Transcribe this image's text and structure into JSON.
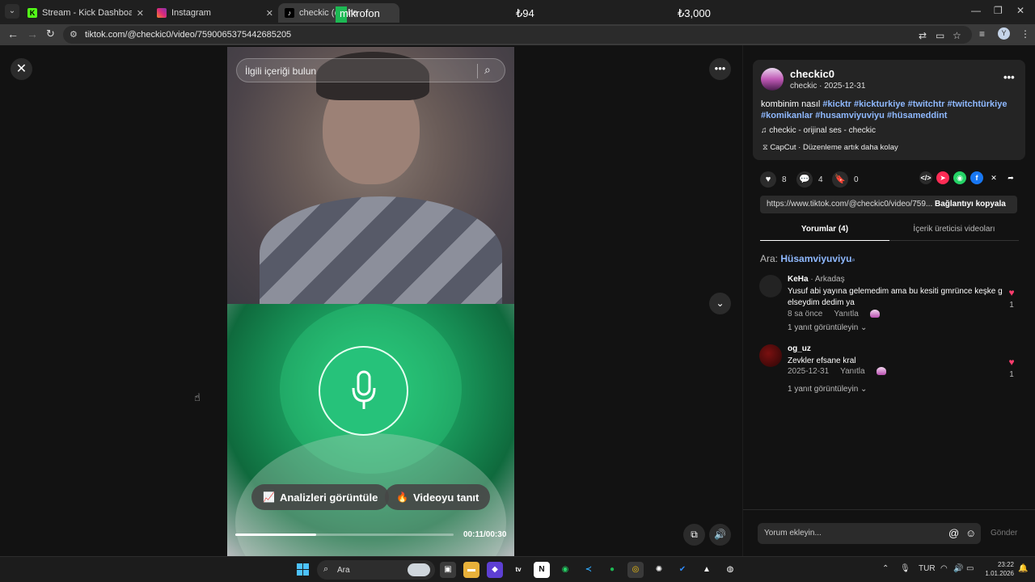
{
  "browser": {
    "tabs": [
      {
        "label": "Stream - Kick Dashboard",
        "favicon": "kick-icon",
        "color": "#53fc18"
      },
      {
        "label": "Instagram",
        "favicon": "instagram-icon",
        "color": "#e1306c"
      },
      {
        "label": "checkic (@che",
        "favicon": "tiktok-icon",
        "color": "#ffffff"
      }
    ],
    "overlay": {
      "mic_label": "mikrofon",
      "amount1": "₺94",
      "amount2": "₺3,000"
    },
    "url": "tiktok.com/@checkic0/video/7590065375442685205",
    "profile_initial": "Y"
  },
  "video": {
    "search_placeholder": "İlgili içeriği bulun",
    "analytics_label": "Analizleri görüntüle",
    "promote_label": "Videoyu tanıt",
    "time": "00:11/00:30",
    "progress": 0.37
  },
  "post": {
    "username": "checkic0",
    "meta": "checkic · 2025-12-31",
    "caption": "kombinim nasıl ",
    "hashtags": "#kicktr #kickturkiye #twitchtr #twitchtürkiye #komikanlar #husamviyuviyu #hüsameddint",
    "sound": "checkic - orijinal ses - checkic",
    "capcut": "CapCut · Düzenleme artık daha kolay",
    "likes": "8",
    "comments": "4",
    "saves": "0",
    "link": "https://www.tiktok.com/@checkic0/video/759...",
    "copy_label": "Bağlantıyı kopyala",
    "tab_comments": "Yorumlar (4)",
    "tab_videos": "İçerik üreticisi videoları",
    "search_prefix": "Ara:",
    "search_term": "Hüsamviyuviyu"
  },
  "comments_list": [
    {
      "name": "KeHa",
      "relation": " · Arkadaş",
      "text": "Yusuf abi yayına gelemedim ama bu kesiti gmrünce keşke g elseydim dedim ya",
      "time": "8 sa önce",
      "reply": "Yanıtla",
      "likes": "1",
      "replies": "1 yanıt görüntüleyin ⌄"
    },
    {
      "name": "og_uz",
      "relation": "",
      "text": "Zevkler efsane kral",
      "time": "2025-12-31",
      "reply": "Yanıtla",
      "likes": "1",
      "replies": "1 yanıt görüntüleyin ⌄"
    }
  ],
  "comment_box": {
    "placeholder": "Yorum ekleyin...",
    "send": "Gönder"
  },
  "taskbar": {
    "search": "Ara",
    "lang": "TUR",
    "time": "23:22",
    "date": "1.01.2026"
  },
  "colors": {
    "accent_tag": "#8fb9ff",
    "like": "#ff3d6e",
    "mic_green": "#26c27a"
  }
}
